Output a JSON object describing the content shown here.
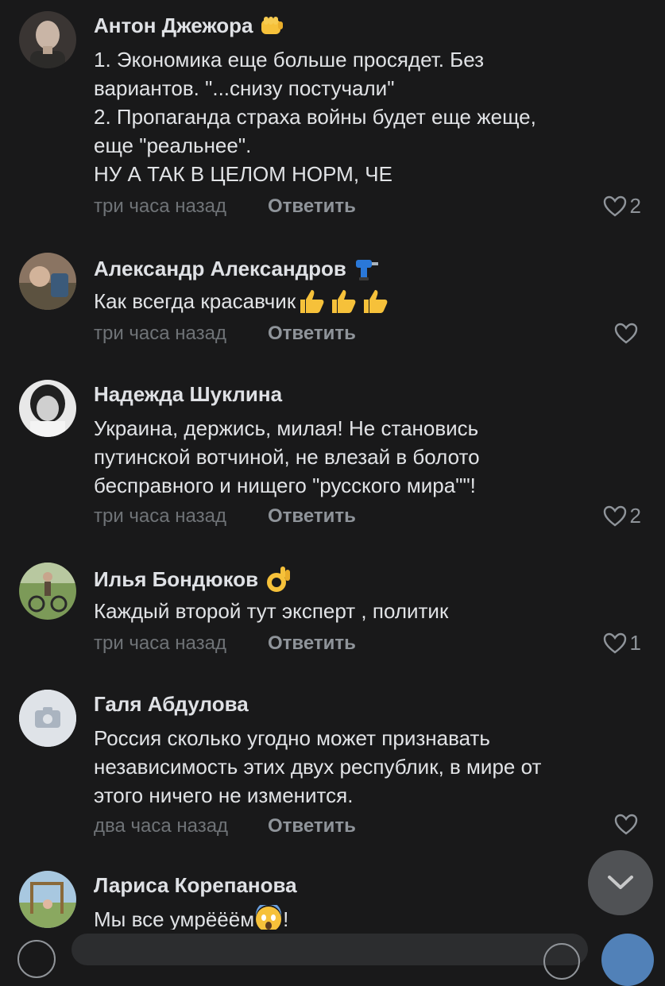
{
  "comments": [
    {
      "name": "Антон Джежора",
      "badge": "fist-emoji",
      "lines": [
        "1. Экономика еще больше просядет. Без",
        "вариантов. \"...снизу постучали\"",
        "2. Пропаганда страха войны будет еще жеще,",
        "еще \"реальнее\".",
        "НУ А ТАК В ЦЕЛОМ НОРМ, ЧЕ"
      ],
      "time": "три часа назад",
      "reply": "Ответить",
      "likes": "2"
    },
    {
      "name": "Александр Александров",
      "badge": "drill-emoji",
      "lines": [
        "Как всегда красавчик"
      ],
      "trailing_emoji": "thumbs-up-x3",
      "time": "три часа назад",
      "reply": "Ответить",
      "likes": ""
    },
    {
      "name": "Надежда Шуклина",
      "lines": [
        "Украина, держись, милая! Не становись",
        "путинской вотчиной, не влезай в болото",
        "бесправного и нищего \"русского мира\"\"!"
      ],
      "time": "три часа назад",
      "reply": "Ответить",
      "likes": "2"
    },
    {
      "name": "Илья Бондюков",
      "badge": "ok-hand-emoji",
      "lines": [
        "Каждый второй тут эксперт , политик"
      ],
      "time": "три часа назад",
      "reply": "Ответить",
      "likes": "1"
    },
    {
      "name": "Галя Абдулова",
      "lines": [
        "Россия сколько угодно может признавать",
        "независимость этих двух республик, в мире от",
        "этого ничего не изменится."
      ],
      "time": "два часа назад",
      "reply": "Ответить",
      "likes": ""
    },
    {
      "name": "Лариса Корепанова",
      "lines": [
        "Мы все умрёёём"
      ],
      "trailing_emoji": "screaming-face",
      "trailing_text": "!",
      "time": "",
      "reply": "",
      "likes": ""
    }
  ],
  "colors": {
    "background": "#19191a",
    "name": "#dfe1e5",
    "text": "#e1e3e6",
    "time": "#6f7377",
    "action": "#8f949a",
    "accent": "#5181b8"
  }
}
